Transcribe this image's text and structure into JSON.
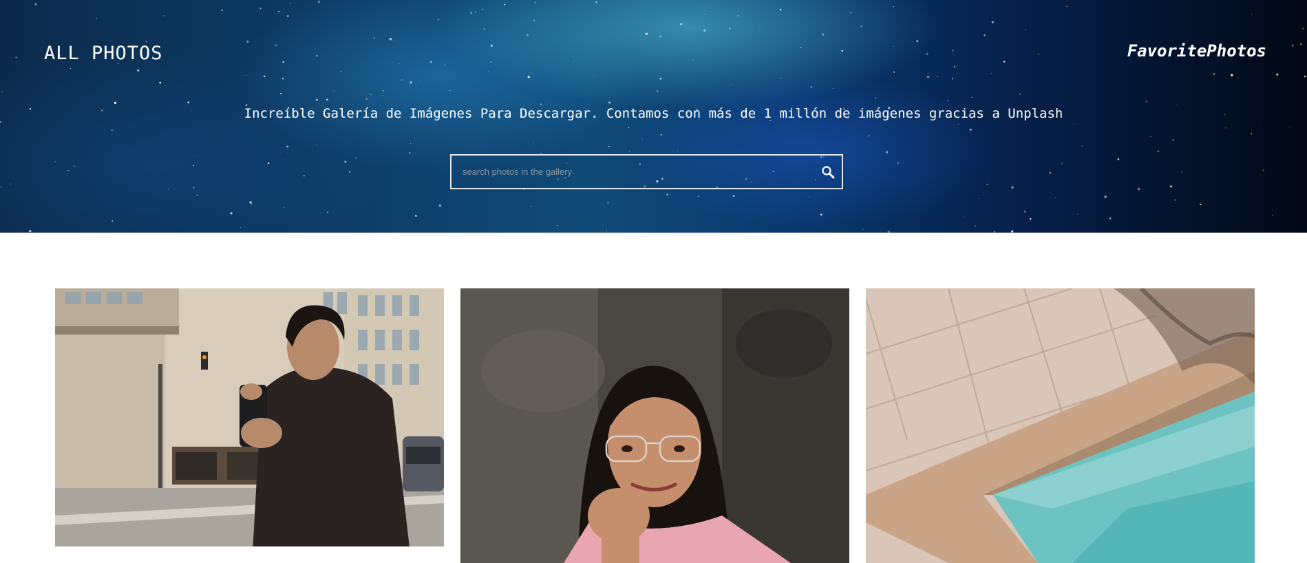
{
  "header": {
    "nav_title": "ALL PHOTOS",
    "brand": "FavoritePhotos",
    "tagline": "Increíble Galería de Imágenes Para Descargar. Contamos con más de 1 millón de imágenes gracias a Unplash",
    "search": {
      "placeholder": "search photos in the gallery",
      "value": "",
      "icon": "search-icon"
    }
  },
  "gallery": {
    "photos": [
      {
        "subject": "man-filming-with-phone-on-street"
      },
      {
        "subject": "smiling-woman-with-glasses"
      },
      {
        "subject": "pool-edge-with-tiles"
      }
    ]
  },
  "colors": {
    "hero_accent": "#0e4a78",
    "text_light": "#ffffff",
    "search_border": "#e8e8e8"
  }
}
